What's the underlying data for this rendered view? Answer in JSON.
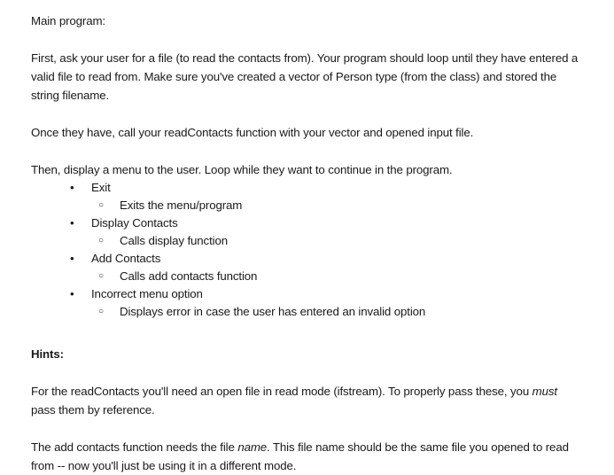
{
  "document": {
    "intro_heading": "Main program:",
    "paragraph_1": "First, ask your user for a file (to read the contacts from). Your program should loop until they have entered a valid file to read from. Make sure you've created a vector of Person type (from the class) and stored the string filename.",
    "paragraph_2": "Once they have, call your readContacts function with your vector and opened input file.",
    "paragraph_3": "Then, display a menu to the user. Loop while they want to continue in the program.",
    "menu_items": [
      {
        "label": "Exit",
        "sub_label": "Exits the menu/program"
      },
      {
        "label": "Display Contacts",
        "sub_label": "Calls display function"
      },
      {
        "label": "Add Contacts",
        "sub_label": "Calls add contacts function"
      },
      {
        "label": "Incorrect menu option",
        "sub_label": "Displays error in case the user has entered an invalid option"
      }
    ],
    "hints_heading": "Hints:",
    "hint_1": {
      "before_italic": "For the readContacts you'll need an open file in read mode (ifstream). To properly pass these, you ",
      "italic": "must",
      "after_italic": " pass them by reference."
    },
    "hint_2": {
      "before_italic": "The add contacts function needs the file ",
      "italic": "name",
      "after_italic": ". This file name should be the same file you opened to read from -- now you'll just be using it in a different mode."
    },
    "markers": {
      "disc": "•",
      "circle": "○"
    }
  }
}
